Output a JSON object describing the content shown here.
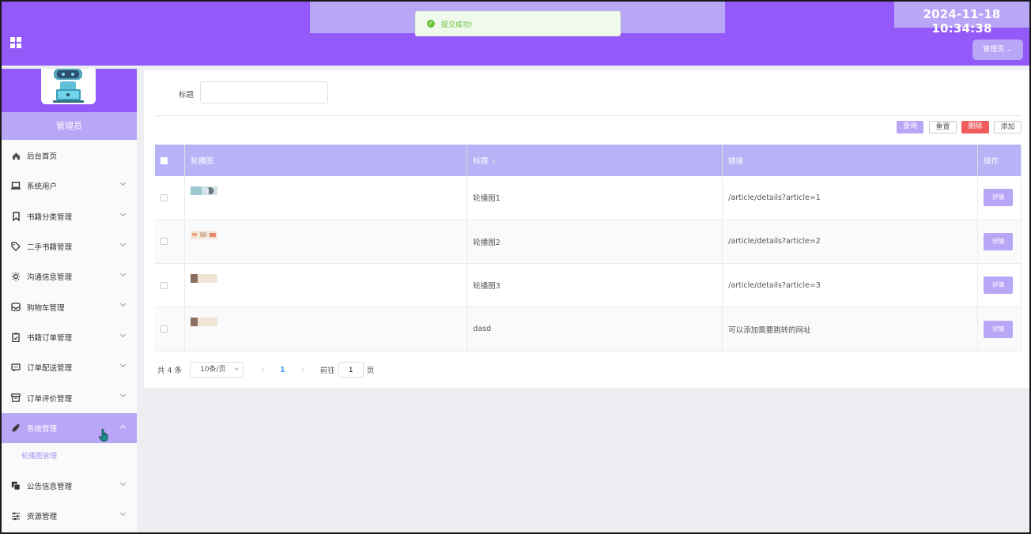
{
  "header": {
    "clock": "2024-11-18 10:34:38",
    "user_menu": "管理员",
    "menu_icon": "grid-icon"
  },
  "toast": {
    "message": "提交成功!",
    "type": "success"
  },
  "sidebar": {
    "role": "管理员",
    "items": [
      {
        "label": "后台首页",
        "icon": "home-icon"
      },
      {
        "label": "系统用户",
        "icon": "laptop-icon"
      },
      {
        "label": "书籍分类管理",
        "icon": "bookmark-icon"
      },
      {
        "label": "二手书籍管理",
        "icon": "tag-icon"
      },
      {
        "label": "沟通信息管理",
        "icon": "sun-icon"
      },
      {
        "label": "购物车管理",
        "icon": "inbox-icon"
      },
      {
        "label": "书籍订单管理",
        "icon": "clipboard-icon"
      },
      {
        "label": "订单配送管理",
        "icon": "chat-icon"
      },
      {
        "label": "订单评价管理",
        "icon": "archive-icon"
      },
      {
        "label": "系统管理",
        "icon": "paperclip-icon"
      },
      {
        "label": "公告信息管理",
        "icon": "copy-icon"
      },
      {
        "label": "资源管理",
        "icon": "sliders-icon"
      }
    ],
    "submenu_active": "轮播图管理"
  },
  "search": {
    "label": "标题",
    "value": ""
  },
  "toolbar": {
    "query": "查询",
    "reset": "重置",
    "delete": "删除",
    "add": "添加"
  },
  "table": {
    "headers": {
      "image": "轮播图",
      "title": "标题",
      "link": "链接",
      "action": "操作"
    },
    "rows": [
      {
        "title": "轮播图1",
        "link": "/article/details?article=1",
        "action": "详情"
      },
      {
        "title": "轮播图2",
        "link": "/article/details?article=2",
        "action": "详情"
      },
      {
        "title": "轮播图3",
        "link": "/article/details?article=3",
        "action": "详情"
      },
      {
        "title": "dasd",
        "link": "可以添加需要跳转的网址",
        "action": "详情"
      }
    ]
  },
  "pagination": {
    "total": "共 4 条",
    "page_size": "10条/页",
    "current_page": "1",
    "goto_prefix": "前往",
    "goto_value": "1",
    "goto_suffix": "页"
  },
  "colors": {
    "primary": "#9459f9",
    "light": "#b8a6f6",
    "danger": "#f05b5b",
    "success": "#67c23a"
  }
}
